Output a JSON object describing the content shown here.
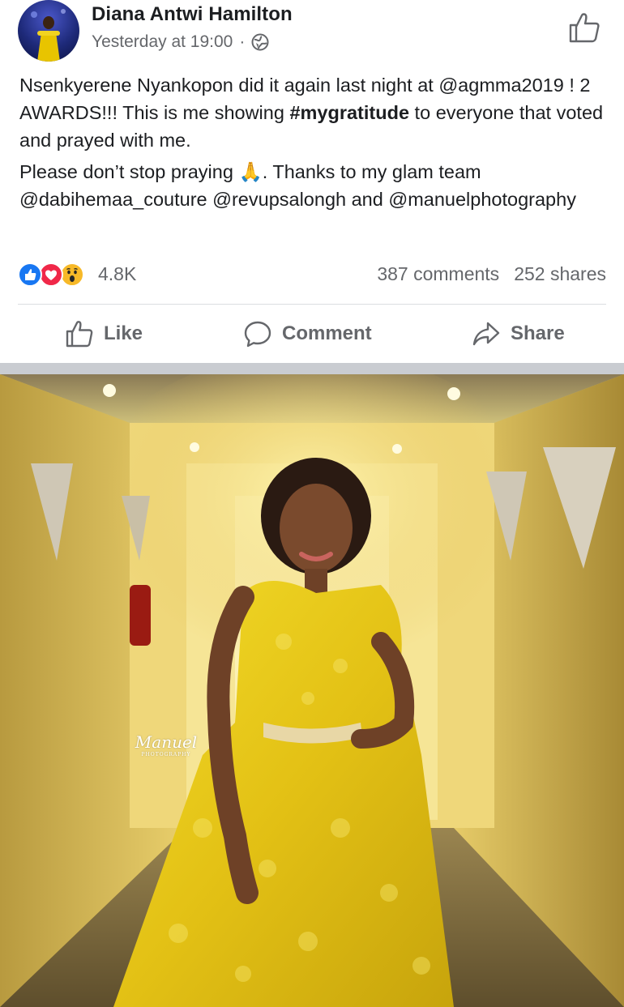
{
  "post": {
    "author_name": "Diana Antwi Hamilton",
    "timestamp": "Yesterday at 19:00",
    "separator_dot": "·",
    "privacy_icon": "globe-icon",
    "text": {
      "line1": "Nsenkyerene Nyankopon did it again last night at @agmma2019 ! 2 AWARDS!!! This is me showing ",
      "hashtag": "#mygratitude",
      "line1_end": " to everyone that voted and prayed with me.",
      "line2_start": "Please don’t stop praying ",
      "emoji": "🙏",
      "line2_end": ". Thanks to my glam team @dabihemaa_couture @revupsalongh and @manuelphotography"
    },
    "reactions": {
      "icons": [
        "like-reaction-icon",
        "love-reaction-icon",
        "wow-reaction-icon"
      ],
      "count": "4.8K"
    },
    "stats": {
      "comments": "387 comments",
      "shares": "252 shares"
    },
    "actions": {
      "like": "Like",
      "comment": "Comment",
      "share": "Share"
    },
    "photo": {
      "watermark_brand": "Manuel",
      "watermark_sub": "PHOTOGRAPHY"
    }
  },
  "colors": {
    "text_primary": "#1c1e21",
    "text_secondary": "#65676b",
    "like_blue": "#1877f2",
    "love_red": "#f02849",
    "wow_yellow": "#f7b928",
    "dress_yellow": "#e8c81a"
  }
}
